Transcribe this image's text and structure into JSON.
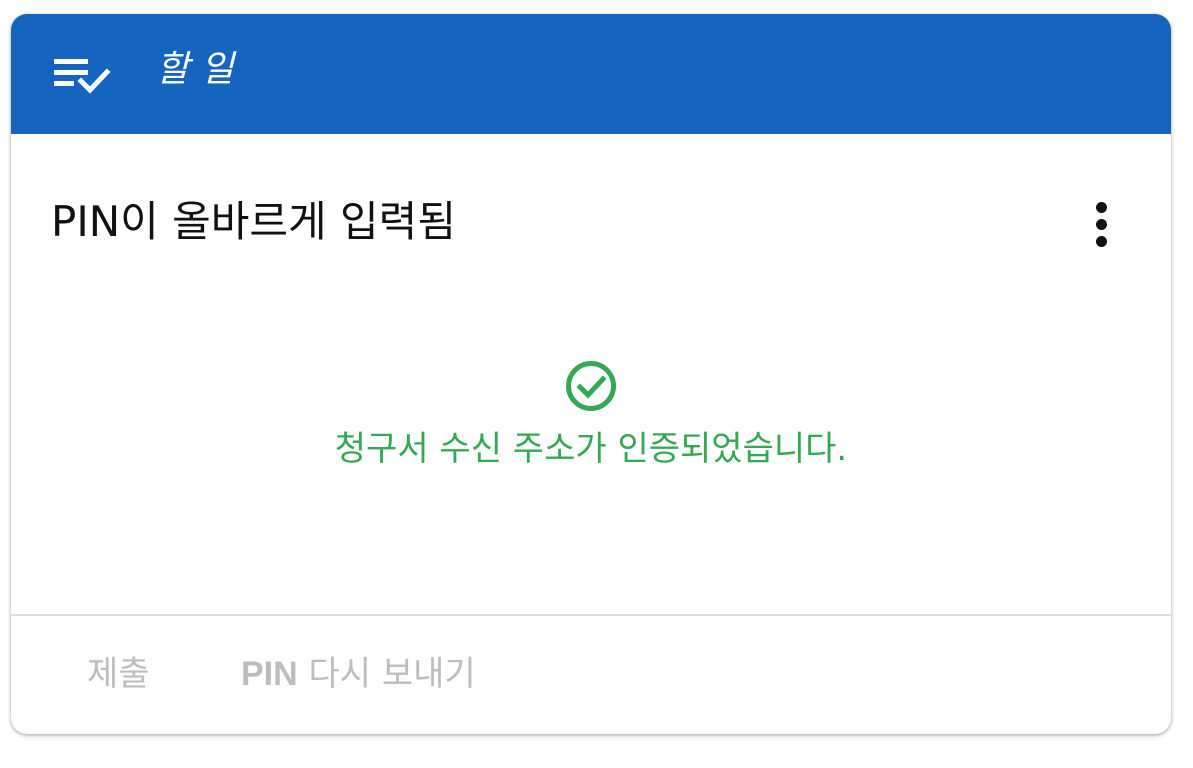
{
  "header": {
    "title": "할 일",
    "icon": "checklist-icon",
    "background_color": "#1565c0"
  },
  "card": {
    "title": "PIN이 올바르게 입력됨",
    "menu_icon": "more-vert-icon"
  },
  "status": {
    "icon": "check-circle-icon",
    "message": "청구서 수신 주소가 인증되었습니다.",
    "color": "#34a853"
  },
  "actions": {
    "submit_label": "제출",
    "resend_label": "PIN 다시 보내기",
    "disabled_color": "#bdbdbd"
  }
}
